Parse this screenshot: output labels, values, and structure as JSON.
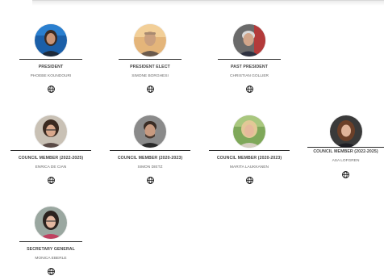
{
  "members": [
    {
      "role": "PRESIDENT",
      "name": "PHOEBE KOUNDOURI",
      "icon": "globe-icon"
    },
    {
      "role": "PRESIDENT ELECT",
      "name": "SIMONE BORGHESI",
      "icon": "globe-icon"
    },
    {
      "role": "PAST PRESIDENT",
      "name": "CHRISTIAN GOLLIER",
      "icon": "globe-icon"
    },
    {
      "role": "COUNCIL MEMBER (2022-2025)",
      "name": "ENRICA DE CIAN",
      "icon": "globe-icon"
    },
    {
      "role": "COUNCIL MEMBER (2020-2023)",
      "name": "SIMON DIETZ",
      "icon": "globe-icon"
    },
    {
      "role": "COUNCIL MEMBER (2020-2023)",
      "name": "MARITA LAUKKANEN",
      "icon": "globe-icon"
    },
    {
      "role": "COUNCIL MEMBER (2022-2025)",
      "name": "ASA LOFGREN",
      "icon": "globe-icon"
    },
    {
      "role": "SECRETARY GENERAL",
      "name": "MONICA EBERLE",
      "icon": "globe-icon"
    }
  ]
}
